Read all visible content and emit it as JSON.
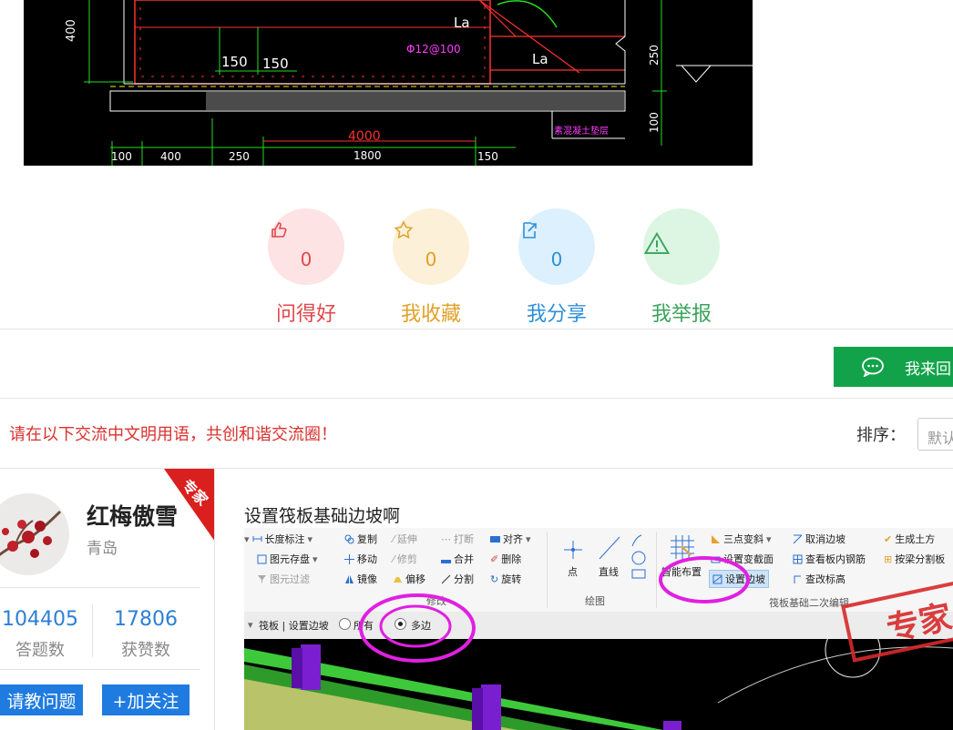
{
  "cad": {
    "dims": {
      "d400v": "400",
      "d150a": "150",
      "d150b": "150",
      "la1": "La",
      "la2": "La",
      "rebar": "Φ12@100",
      "d250v": "250",
      "d100v": "100",
      "d4000": "4000",
      "b100": "100",
      "b400": "400",
      "b250": "250",
      "b1800": "1800",
      "b150": "150",
      "layer_note": "素混凝土垫层"
    }
  },
  "actions": [
    {
      "icon": "thumbs-up-icon",
      "count": "0",
      "label": "问得好",
      "color": "#e2474b",
      "bg": "#fde3e4"
    },
    {
      "icon": "star-icon",
      "count": "0",
      "label": "我收藏",
      "color": "#e0a128",
      "bg": "#fdf0d8"
    },
    {
      "icon": "share-icon",
      "count": "0",
      "label": "我分享",
      "color": "#2f8fd8",
      "bg": "#dcf0fd"
    },
    {
      "icon": "warning-icon",
      "count": "",
      "label": "我举报",
      "color": "#3aa45b",
      "bg": "#dcf6e3"
    }
  ],
  "reply_button": {
    "label": "我来回"
  },
  "notice": "请在以下交流中文明用语，共创和谐交流圈！",
  "sort": {
    "label": "排序：",
    "value": "默认"
  },
  "user": {
    "badge": "专家",
    "name": "红梅傲雪",
    "city": "青岛",
    "answers": "104405",
    "answers_label": "答题数",
    "likes": "17806",
    "likes_label": "获赞数",
    "ask_button": "请教问题",
    "follow_button": "+加关注"
  },
  "answer": {
    "title": "设置筏板基础边坡啊",
    "ribbon": {
      "col1": [
        "长度标注",
        "图元存盘",
        "图元过滤"
      ],
      "col2": [
        "复制",
        "移动",
        "镜像"
      ],
      "col3": [
        "延伸",
        "修剪",
        "偏移"
      ],
      "col4": [
        "打断",
        "合并",
        "分割"
      ],
      "col5": [
        "对齐",
        "删除",
        "旋转"
      ],
      "group_modify": "修改",
      "draw_point": "点",
      "draw_line": "直线",
      "group_draw": "绘图",
      "smart": "智能布置",
      "col6": [
        "三点变斜",
        "设置变截面",
        "设置边坡"
      ],
      "col7": [
        "取消边坡",
        "查看板内钢筋",
        "查改标高"
      ],
      "col8": [
        "生成土方",
        "按梁分割板"
      ],
      "group_raft": "筏板基础二次编辑"
    },
    "options": {
      "prefix": "筏板 | 设置边坡",
      "opt_all": "所有",
      "opt_multi": "多边"
    },
    "watermark": "专家"
  }
}
